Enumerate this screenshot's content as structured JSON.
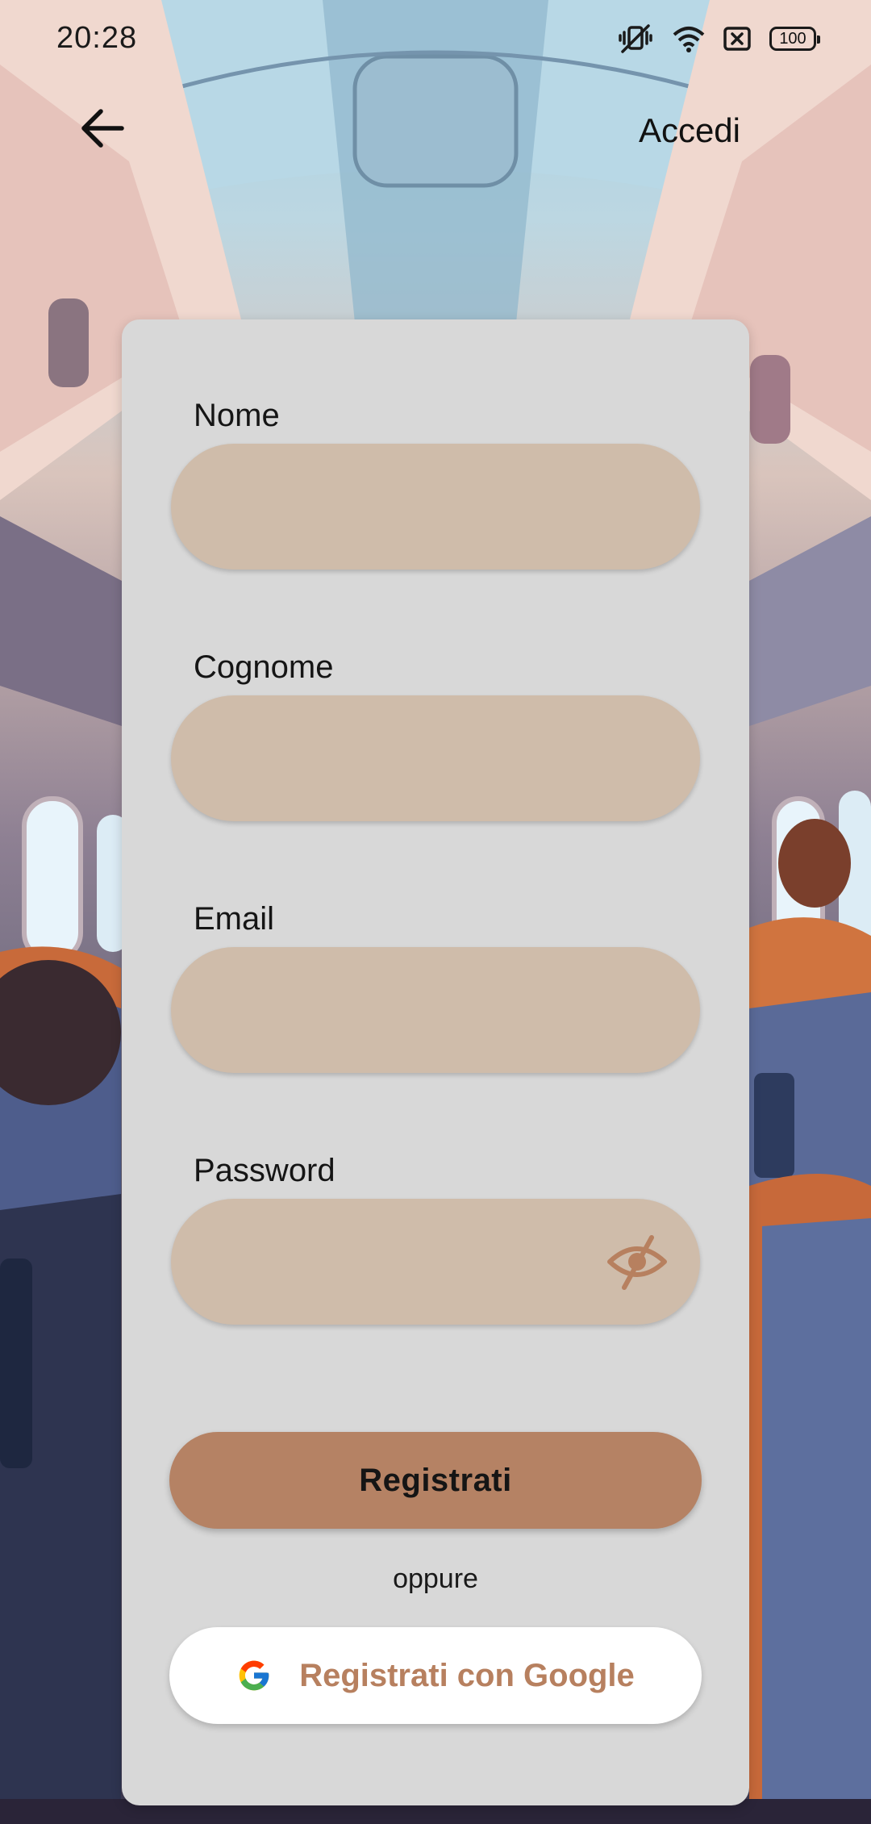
{
  "status_bar": {
    "time": "20:28",
    "battery": "100",
    "icons": [
      "vibrate-icon",
      "wifi-icon",
      "sim-x-icon",
      "battery-icon"
    ]
  },
  "app_bar": {
    "back_icon": "arrow-left-icon",
    "login_label": "Accedi"
  },
  "form": {
    "first_name": {
      "label": "Nome",
      "value": ""
    },
    "last_name": {
      "label": "Cognome",
      "value": ""
    },
    "email": {
      "label": "Email",
      "value": ""
    },
    "password": {
      "label": "Password",
      "value": "",
      "toggle_icon": "eye-off-icon"
    }
  },
  "actions": {
    "register_label": "Registrati",
    "or_label": "oppure",
    "google_label": "Registrati con Google",
    "google_icon": "google-g-icon"
  },
  "colors": {
    "field_fill": "#cfbcaa",
    "primary_button": "#b58264",
    "google_text": "#b7805f",
    "card": "#d8d8d8"
  }
}
